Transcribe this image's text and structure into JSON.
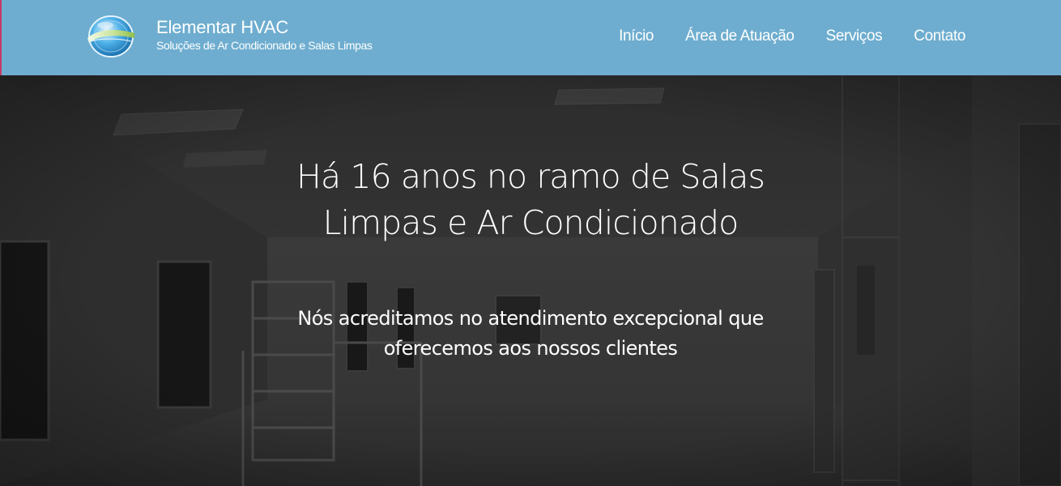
{
  "header": {
    "brand_name": "Elementar HVAC",
    "brand_tagline": "Soluções de Ar Condicionado e Salas Limpas",
    "nav": [
      {
        "label": "Início"
      },
      {
        "label": "Área de Atuação"
      },
      {
        "label": "Serviços"
      },
      {
        "label": "Contato"
      }
    ]
  },
  "hero": {
    "title_line1": "Há 16 anos no ramo de Salas",
    "title_line2": "Limpas e Ar Condicionado",
    "subtitle_line1": "Nós acreditamos no atendimento excepcional que",
    "subtitle_line2": "oferecemos aos nossos clientes"
  },
  "colors": {
    "navbar": "#6eadcf",
    "hero_overlay": "#262626",
    "text": "#ffffff"
  }
}
